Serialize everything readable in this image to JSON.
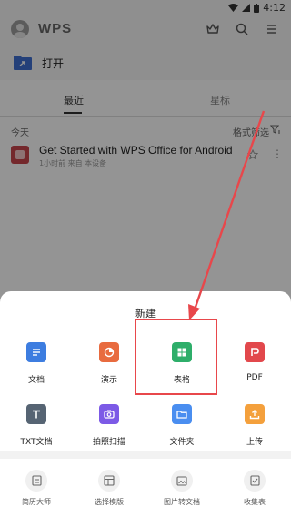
{
  "status_bar": {
    "time": "4:12"
  },
  "app": {
    "logo_text": "WPS"
  },
  "header": {
    "icons": [
      "crown-icon",
      "search-icon",
      "menu-icon"
    ]
  },
  "open_row": {
    "label": "打开"
  },
  "tabs": [
    {
      "label": "最近",
      "active": true
    },
    {
      "label": "星标",
      "active": false
    }
  ],
  "recent": {
    "section_label": "今天",
    "sort_label": "格式筛选",
    "files": [
      {
        "name": "Get Started with WPS Office for Android",
        "meta": "1小时前 来自 本设备"
      }
    ]
  },
  "sheet": {
    "title": "新建",
    "items": [
      {
        "label": "文档",
        "icon": "document-icon",
        "color": "#3d7de0"
      },
      {
        "label": "演示",
        "icon": "presentation-icon",
        "color": "#e86b3f"
      },
      {
        "label": "表格",
        "icon": "spreadsheet-icon",
        "color": "#2eae6a"
      },
      {
        "label": "PDF",
        "icon": "pdf-icon",
        "color": "#e2484c"
      },
      {
        "label": "TXT文档",
        "icon": "txt-icon",
        "color": "#566473"
      },
      {
        "label": "拍照扫描",
        "icon": "camera-icon",
        "color": "#7c5ae6"
      },
      {
        "label": "文件夹",
        "icon": "folder-icon",
        "color": "#4a8ef0"
      },
      {
        "label": "上传",
        "icon": "upload-icon",
        "color": "#f4a03c"
      }
    ],
    "tools": [
      {
        "label": "简历大师",
        "icon": "resume-icon"
      },
      {
        "label": "选择模版",
        "icon": "template-icon"
      },
      {
        "label": "图片转文档",
        "icon": "image-to-doc-icon"
      },
      {
        "label": "收集表",
        "icon": "form-icon"
      }
    ]
  },
  "annotation": {
    "highlight_color": "#e8474b",
    "highlighted_item": "表格"
  }
}
